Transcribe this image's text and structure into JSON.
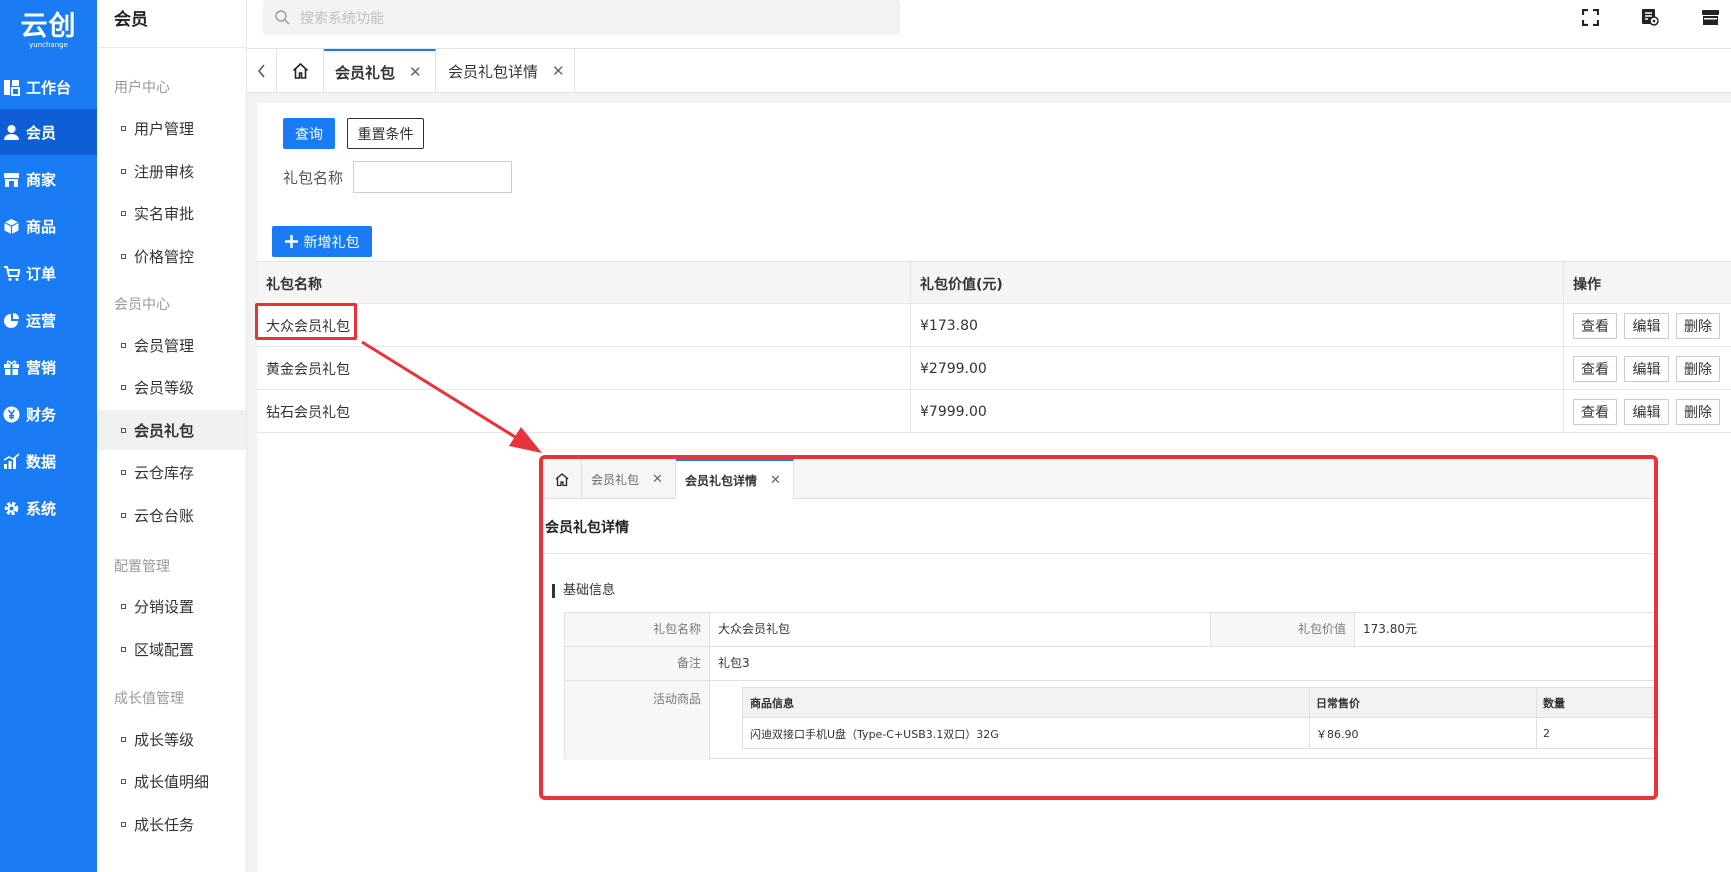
{
  "brand": {
    "logo_text": "云创",
    "logo_sub": "yunchange"
  },
  "nav": [
    {
      "label": "工作台",
      "icon": "dashboard-icon"
    },
    {
      "label": "会员",
      "icon": "user-icon",
      "active": true
    },
    {
      "label": "商家",
      "icon": "store-icon"
    },
    {
      "label": "商品",
      "icon": "box-icon"
    },
    {
      "label": "订单",
      "icon": "cart-icon"
    },
    {
      "label": "运营",
      "icon": "pie-chart-icon"
    },
    {
      "label": "营销",
      "icon": "gift-icon"
    },
    {
      "label": "财务",
      "icon": "yen-icon"
    },
    {
      "label": "数据",
      "icon": "bar-chart-icon"
    },
    {
      "label": "系统",
      "icon": "gear-icon"
    }
  ],
  "submenu": {
    "title": "会员",
    "groups": [
      {
        "title": "用户中心",
        "items": [
          "用户管理",
          "注册审核",
          "实名审批",
          "价格管控"
        ]
      },
      {
        "title": "会员中心",
        "items": [
          "会员管理",
          "会员等级",
          "会员礼包",
          "云仓库存",
          "云仓台账"
        ]
      },
      {
        "title": "配置管理",
        "items": [
          "分销设置",
          "区域配置"
        ]
      },
      {
        "title": "成长值管理",
        "items": [
          "成长等级",
          "成长值明细",
          "成长任务"
        ]
      }
    ],
    "active_item": "会员礼包"
  },
  "search": {
    "placeholder": "搜索系统功能"
  },
  "tabs": [
    {
      "label": "会员礼包",
      "active": true
    },
    {
      "label": "会员礼包详情",
      "active": false
    }
  ],
  "filter": {
    "query_label": "查询",
    "reset_label": "重置条件",
    "name_label": "礼包名称",
    "name_value": ""
  },
  "add_button": "新增礼包",
  "table": {
    "headers": [
      "礼包名称",
      "礼包价值(元)",
      "操作"
    ],
    "rows": [
      {
        "name": "大众会员礼包",
        "value": "¥173.80"
      },
      {
        "name": "黄金会员礼包",
        "value": "¥2799.00"
      },
      {
        "name": "钻石会员礼包",
        "value": "¥7999.00"
      }
    ],
    "actions": [
      "查看",
      "编辑",
      "删除"
    ]
  },
  "popup": {
    "tabs": [
      {
        "label": "会员礼包",
        "active": false
      },
      {
        "label": "会员礼包详情",
        "active": true
      }
    ],
    "title": "会员礼包详情",
    "section": "基础信息",
    "fields": {
      "name_label": "礼包名称",
      "name_value": "大众会员礼包",
      "value_label": "礼包价值",
      "value_value": "173.80元",
      "remark_label": "备注",
      "remark_value": "礼包3",
      "goods_label": "活动商品"
    },
    "goods_table": {
      "headers": [
        "商品信息",
        "日常售价",
        "数量"
      ],
      "rows": [
        {
          "info": "闪迪双接口手机U盘（Type-C+USB3.1双口）32G",
          "price": "￥86.90",
          "qty": "2"
        }
      ]
    }
  },
  "colors": {
    "primary": "#1a7cf5",
    "highlight": "#e8333b"
  }
}
